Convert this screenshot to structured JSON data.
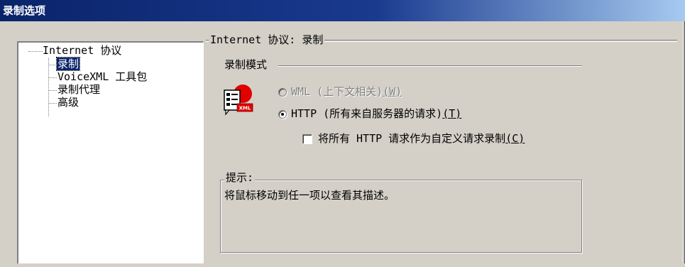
{
  "window": {
    "title": "录制选项"
  },
  "tree": {
    "root": "Internet 协议",
    "items": [
      {
        "label": "录制",
        "selected": true
      },
      {
        "label": "VoiceXML 工具包",
        "selected": false
      },
      {
        "label": "录制代理",
        "selected": false
      },
      {
        "label": "高级",
        "selected": false
      }
    ]
  },
  "panel": {
    "title": "Internet 协议: 录制",
    "mode_label": "录制模式",
    "options": [
      {
        "label": "WML (上下文相关)",
        "mnemonic": "(W)",
        "enabled": false,
        "checked": false
      },
      {
        "label": "HTTP (所有来自服务器的请求)",
        "mnemonic": "(T)",
        "enabled": true,
        "checked": true
      }
    ],
    "checkbox": {
      "label": "将所有 HTTP 请求作为自定义请求录制",
      "mnemonic": "(C)",
      "checked": false
    },
    "mode_icon": "xml-document-icon"
  },
  "hint": {
    "title": "提示:",
    "text": "将鼠标移动到任一项以查看其描述。"
  }
}
